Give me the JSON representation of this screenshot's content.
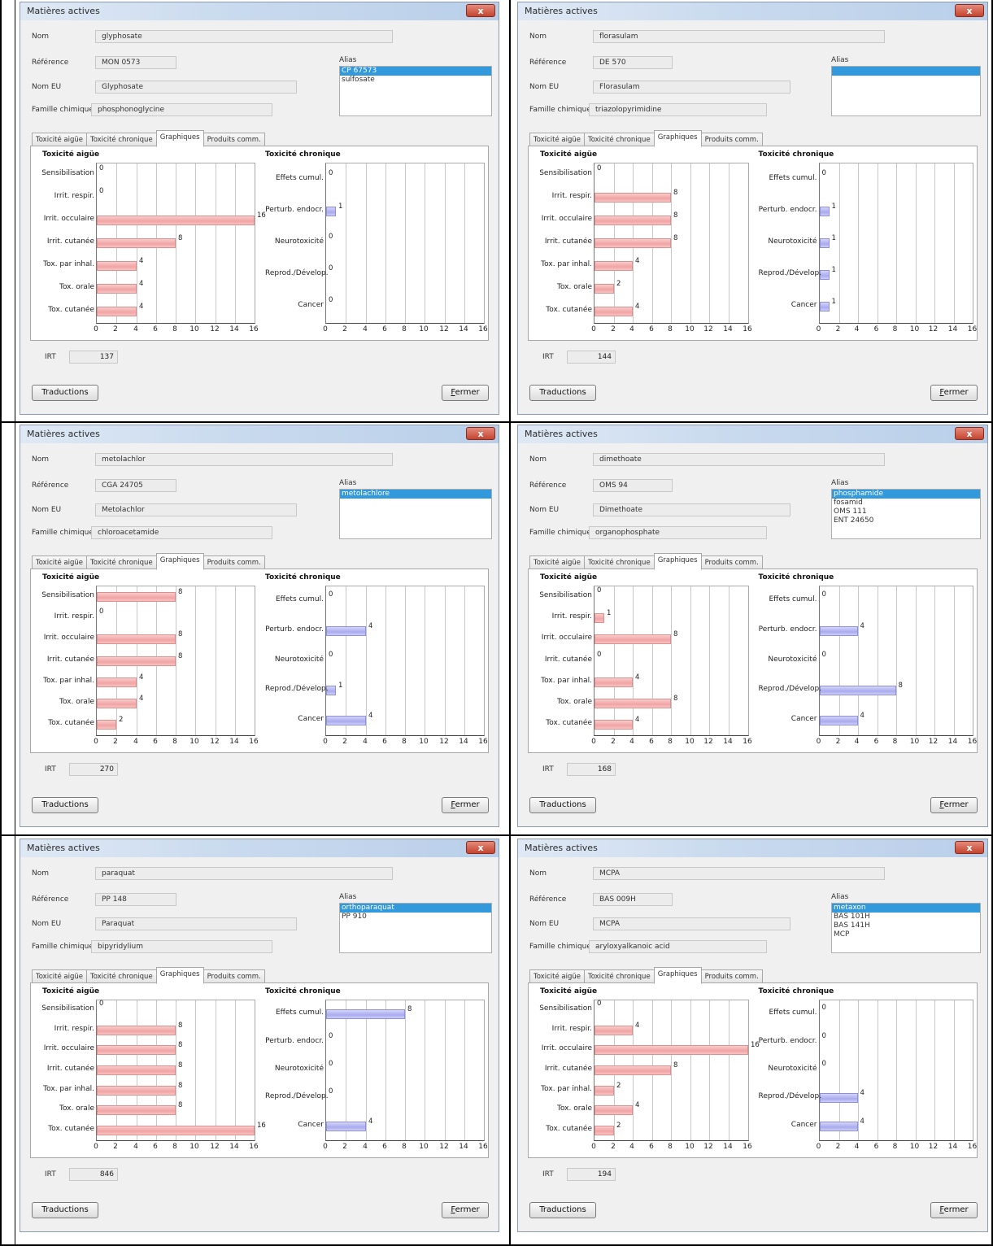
{
  "shared": {
    "window_title": "Matières actives",
    "close_glyph": "x",
    "labels": {
      "nom": "Nom",
      "reference": "Référence",
      "nom_eu": "Nom EU",
      "famille": "Famille chimique",
      "alias": "Alias",
      "irt": "IRT"
    },
    "tabs": [
      "Toxicité aigüe",
      "Toxicité chronique",
      "Graphiques",
      "Produits comm."
    ],
    "active_tab_index": 2,
    "acute_title": "Toxicité aigüe",
    "chronic_title": "Toxicité chronique",
    "acute_categories": [
      "Sensibilisation",
      "Irrit. respir.",
      "Irrit. occulaire",
      "Irrit. cutanée",
      "Tox. par inhal.",
      "Tox. orale",
      "Tox. cutanée"
    ],
    "chronic_categories": [
      "Effets cumul.",
      "Perturb. endocr.",
      "Neurotoxicité",
      "Reprod./Dévelop.",
      "Cancer"
    ],
    "x_ticks": [
      "0",
      "2",
      "4",
      "6",
      "8",
      "10",
      "12",
      "14",
      "16"
    ],
    "translations_button": "Traductions",
    "close_button_first": "F",
    "close_button_rest": "ermer",
    "colors": {
      "acute_bar": "#f3a3a3",
      "chronic_bar": "#a9aaf0",
      "alias_selected": "#3399dd"
    }
  },
  "windows": [
    {
      "nom": "glyphosate",
      "reference": "MON 0573",
      "nom_eu": "Glyphosate",
      "famille": "phosphonoglycine",
      "alias": [
        "CP 67573",
        "sulfosate"
      ],
      "alias_selected": 0,
      "irt": "137"
    },
    {
      "nom": "florasulam",
      "reference": "DE 570",
      "nom_eu": "Florasulam",
      "famille": "triazolopyrimidine",
      "alias": [
        ""
      ],
      "alias_selected": 0,
      "irt": "144"
    },
    {
      "nom": "metolachlor",
      "reference": "CGA 24705",
      "nom_eu": "Metolachlor",
      "famille": "chloroacetamide",
      "alias": [
        "metolachlore"
      ],
      "alias_selected": 0,
      "irt": "270"
    },
    {
      "nom": "dimethoate",
      "reference": "OMS 94",
      "nom_eu": "Dimethoate",
      "famille": "organophosphate",
      "alias": [
        "phosphamide",
        "fosamid",
        "OMS 111",
        "ENT 24650"
      ],
      "alias_selected": 0,
      "irt": "168"
    },
    {
      "nom": "paraquat",
      "reference": "PP 148",
      "nom_eu": "Paraquat",
      "famille": "bipyridylium",
      "alias": [
        "orthoparaquat",
        "PP 910"
      ],
      "alias_selected": 0,
      "irt": "846"
    },
    {
      "nom": "MCPA",
      "reference": "BAS 009H",
      "nom_eu": "MCPA",
      "famille": "aryloxyalkanoic acid",
      "alias": [
        "metaxon",
        "BAS 101H",
        "BAS 141H",
        "MCP"
      ],
      "alias_selected": 0,
      "irt": "194"
    }
  ],
  "chart_data": [
    {
      "type": "bar",
      "title": "Toxicité aigüe",
      "window": "glyphosate",
      "orientation": "horizontal",
      "xlim": [
        0,
        16
      ],
      "categories": [
        "Sensibilisation",
        "Irrit. respir.",
        "Irrit. occulaire",
        "Irrit. cutanée",
        "Tox. par inhal.",
        "Tox. orale",
        "Tox. cutanée"
      ],
      "values": [
        0,
        0,
        16,
        8,
        4,
        4,
        4
      ]
    },
    {
      "type": "bar",
      "title": "Toxicité chronique",
      "window": "glyphosate",
      "orientation": "horizontal",
      "xlim": [
        0,
        16
      ],
      "categories": [
        "Effets cumul.",
        "Perturb. endocr.",
        "Neurotoxicité",
        "Reprod./Dévelop.",
        "Cancer"
      ],
      "values": [
        0,
        1,
        0,
        0,
        0
      ]
    },
    {
      "type": "bar",
      "title": "Toxicité aigüe",
      "window": "florasulam",
      "orientation": "horizontal",
      "xlim": [
        0,
        16
      ],
      "categories": [
        "Sensibilisation",
        "Irrit. respir.",
        "Irrit. occulaire",
        "Irrit. cutanée",
        "Tox. par inhal.",
        "Tox. orale",
        "Tox. cutanée"
      ],
      "values": [
        0,
        8,
        8,
        8,
        4,
        2,
        4
      ]
    },
    {
      "type": "bar",
      "title": "Toxicité chronique",
      "window": "florasulam",
      "orientation": "horizontal",
      "xlim": [
        0,
        16
      ],
      "categories": [
        "Effets cumul.",
        "Perturb. endocr.",
        "Neurotoxicité",
        "Reprod./Dévelop.",
        "Cancer"
      ],
      "values": [
        0,
        1,
        1,
        1,
        1
      ]
    },
    {
      "type": "bar",
      "title": "Toxicité aigüe",
      "window": "metolachlor",
      "orientation": "horizontal",
      "xlim": [
        0,
        16
      ],
      "categories": [
        "Sensibilisation",
        "Irrit. respir.",
        "Irrit. occulaire",
        "Irrit. cutanée",
        "Tox. par inhal.",
        "Tox. orale",
        "Tox. cutanée"
      ],
      "values": [
        8,
        0,
        8,
        8,
        4,
        4,
        2
      ]
    },
    {
      "type": "bar",
      "title": "Toxicité chronique",
      "window": "metolachlor",
      "orientation": "horizontal",
      "xlim": [
        0,
        16
      ],
      "categories": [
        "Effets cumul.",
        "Perturb. endocr.",
        "Neurotoxicité",
        "Reprod./Dévelop.",
        "Cancer"
      ],
      "values": [
        0,
        4,
        0,
        1,
        4
      ]
    },
    {
      "type": "bar",
      "title": "Toxicité aigüe",
      "window": "dimethoate",
      "orientation": "horizontal",
      "xlim": [
        0,
        16
      ],
      "categories": [
        "Sensibilisation",
        "Irrit. respir.",
        "Irrit. occulaire",
        "Irrit. cutanée",
        "Tox. par inhal.",
        "Tox. orale",
        "Tox. cutanée"
      ],
      "values": [
        0,
        1,
        8,
        0,
        4,
        8,
        4
      ]
    },
    {
      "type": "bar",
      "title": "Toxicité chronique",
      "window": "dimethoate",
      "orientation": "horizontal",
      "xlim": [
        0,
        16
      ],
      "categories": [
        "Effets cumul.",
        "Perturb. endocr.",
        "Neurotoxicité",
        "Reprod./Dévelop.",
        "Cancer"
      ],
      "values": [
        0,
        4,
        0,
        8,
        4
      ]
    },
    {
      "type": "bar",
      "title": "Toxicité aigüe",
      "window": "paraquat",
      "orientation": "horizontal",
      "xlim": [
        0,
        16
      ],
      "categories": [
        "Sensibilisation",
        "Irrit. respir.",
        "Irrit. occulaire",
        "Irrit. cutanée",
        "Tox. par inhal.",
        "Tox. orale",
        "Tox. cutanée"
      ],
      "values": [
        0,
        8,
        8,
        8,
        8,
        8,
        16
      ]
    },
    {
      "type": "bar",
      "title": "Toxicité chronique",
      "window": "paraquat",
      "orientation": "horizontal",
      "xlim": [
        0,
        16
      ],
      "categories": [
        "Effets cumul.",
        "Perturb. endocr.",
        "Neurotoxicité",
        "Reprod./Dévelop.",
        "Cancer"
      ],
      "values": [
        8,
        0,
        0,
        0,
        4
      ]
    },
    {
      "type": "bar",
      "title": "Toxicité aigüe",
      "window": "MCPA",
      "orientation": "horizontal",
      "xlim": [
        0,
        16
      ],
      "categories": [
        "Sensibilisation",
        "Irrit. respir.",
        "Irrit. occulaire",
        "Irrit. cutanée",
        "Tox. par inhal.",
        "Tox. orale",
        "Tox. cutanée"
      ],
      "values": [
        0,
        4,
        16,
        8,
        2,
        4,
        2
      ]
    },
    {
      "type": "bar",
      "title": "Toxicité chronique",
      "window": "MCPA",
      "orientation": "horizontal",
      "xlim": [
        0,
        16
      ],
      "categories": [
        "Effets cumul.",
        "Perturb. endocr.",
        "Neurotoxicité",
        "Reprod./Dévelop.",
        "Cancer"
      ],
      "values": [
        0,
        0,
        0,
        4,
        4
      ]
    }
  ]
}
